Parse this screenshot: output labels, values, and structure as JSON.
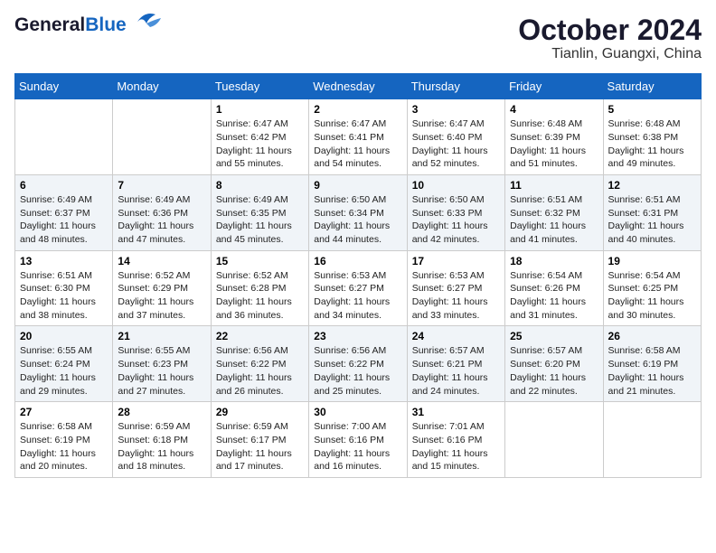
{
  "header": {
    "logo_general": "General",
    "logo_blue": "Blue",
    "month": "October 2024",
    "location": "Tianlin, Guangxi, China"
  },
  "weekdays": [
    "Sunday",
    "Monday",
    "Tuesday",
    "Wednesday",
    "Thursday",
    "Friday",
    "Saturday"
  ],
  "weeks": [
    [
      {
        "day": "",
        "sunrise": "",
        "sunset": "",
        "daylight": ""
      },
      {
        "day": "",
        "sunrise": "",
        "sunset": "",
        "daylight": ""
      },
      {
        "day": "1",
        "sunrise": "Sunrise: 6:47 AM",
        "sunset": "Sunset: 6:42 PM",
        "daylight": "Daylight: 11 hours and 55 minutes."
      },
      {
        "day": "2",
        "sunrise": "Sunrise: 6:47 AM",
        "sunset": "Sunset: 6:41 PM",
        "daylight": "Daylight: 11 hours and 54 minutes."
      },
      {
        "day": "3",
        "sunrise": "Sunrise: 6:47 AM",
        "sunset": "Sunset: 6:40 PM",
        "daylight": "Daylight: 11 hours and 52 minutes."
      },
      {
        "day": "4",
        "sunrise": "Sunrise: 6:48 AM",
        "sunset": "Sunset: 6:39 PM",
        "daylight": "Daylight: 11 hours and 51 minutes."
      },
      {
        "day": "5",
        "sunrise": "Sunrise: 6:48 AM",
        "sunset": "Sunset: 6:38 PM",
        "daylight": "Daylight: 11 hours and 49 minutes."
      }
    ],
    [
      {
        "day": "6",
        "sunrise": "Sunrise: 6:49 AM",
        "sunset": "Sunset: 6:37 PM",
        "daylight": "Daylight: 11 hours and 48 minutes."
      },
      {
        "day": "7",
        "sunrise": "Sunrise: 6:49 AM",
        "sunset": "Sunset: 6:36 PM",
        "daylight": "Daylight: 11 hours and 47 minutes."
      },
      {
        "day": "8",
        "sunrise": "Sunrise: 6:49 AM",
        "sunset": "Sunset: 6:35 PM",
        "daylight": "Daylight: 11 hours and 45 minutes."
      },
      {
        "day": "9",
        "sunrise": "Sunrise: 6:50 AM",
        "sunset": "Sunset: 6:34 PM",
        "daylight": "Daylight: 11 hours and 44 minutes."
      },
      {
        "day": "10",
        "sunrise": "Sunrise: 6:50 AM",
        "sunset": "Sunset: 6:33 PM",
        "daylight": "Daylight: 11 hours and 42 minutes."
      },
      {
        "day": "11",
        "sunrise": "Sunrise: 6:51 AM",
        "sunset": "Sunset: 6:32 PM",
        "daylight": "Daylight: 11 hours and 41 minutes."
      },
      {
        "day": "12",
        "sunrise": "Sunrise: 6:51 AM",
        "sunset": "Sunset: 6:31 PM",
        "daylight": "Daylight: 11 hours and 40 minutes."
      }
    ],
    [
      {
        "day": "13",
        "sunrise": "Sunrise: 6:51 AM",
        "sunset": "Sunset: 6:30 PM",
        "daylight": "Daylight: 11 hours and 38 minutes."
      },
      {
        "day": "14",
        "sunrise": "Sunrise: 6:52 AM",
        "sunset": "Sunset: 6:29 PM",
        "daylight": "Daylight: 11 hours and 37 minutes."
      },
      {
        "day": "15",
        "sunrise": "Sunrise: 6:52 AM",
        "sunset": "Sunset: 6:28 PM",
        "daylight": "Daylight: 11 hours and 36 minutes."
      },
      {
        "day": "16",
        "sunrise": "Sunrise: 6:53 AM",
        "sunset": "Sunset: 6:27 PM",
        "daylight": "Daylight: 11 hours and 34 minutes."
      },
      {
        "day": "17",
        "sunrise": "Sunrise: 6:53 AM",
        "sunset": "Sunset: 6:27 PM",
        "daylight": "Daylight: 11 hours and 33 minutes."
      },
      {
        "day": "18",
        "sunrise": "Sunrise: 6:54 AM",
        "sunset": "Sunset: 6:26 PM",
        "daylight": "Daylight: 11 hours and 31 minutes."
      },
      {
        "day": "19",
        "sunrise": "Sunrise: 6:54 AM",
        "sunset": "Sunset: 6:25 PM",
        "daylight": "Daylight: 11 hours and 30 minutes."
      }
    ],
    [
      {
        "day": "20",
        "sunrise": "Sunrise: 6:55 AM",
        "sunset": "Sunset: 6:24 PM",
        "daylight": "Daylight: 11 hours and 29 minutes."
      },
      {
        "day": "21",
        "sunrise": "Sunrise: 6:55 AM",
        "sunset": "Sunset: 6:23 PM",
        "daylight": "Daylight: 11 hours and 27 minutes."
      },
      {
        "day": "22",
        "sunrise": "Sunrise: 6:56 AM",
        "sunset": "Sunset: 6:22 PM",
        "daylight": "Daylight: 11 hours and 26 minutes."
      },
      {
        "day": "23",
        "sunrise": "Sunrise: 6:56 AM",
        "sunset": "Sunset: 6:22 PM",
        "daylight": "Daylight: 11 hours and 25 minutes."
      },
      {
        "day": "24",
        "sunrise": "Sunrise: 6:57 AM",
        "sunset": "Sunset: 6:21 PM",
        "daylight": "Daylight: 11 hours and 24 minutes."
      },
      {
        "day": "25",
        "sunrise": "Sunrise: 6:57 AM",
        "sunset": "Sunset: 6:20 PM",
        "daylight": "Daylight: 11 hours and 22 minutes."
      },
      {
        "day": "26",
        "sunrise": "Sunrise: 6:58 AM",
        "sunset": "Sunset: 6:19 PM",
        "daylight": "Daylight: 11 hours and 21 minutes."
      }
    ],
    [
      {
        "day": "27",
        "sunrise": "Sunrise: 6:58 AM",
        "sunset": "Sunset: 6:19 PM",
        "daylight": "Daylight: 11 hours and 20 minutes."
      },
      {
        "day": "28",
        "sunrise": "Sunrise: 6:59 AM",
        "sunset": "Sunset: 6:18 PM",
        "daylight": "Daylight: 11 hours and 18 minutes."
      },
      {
        "day": "29",
        "sunrise": "Sunrise: 6:59 AM",
        "sunset": "Sunset: 6:17 PM",
        "daylight": "Daylight: 11 hours and 17 minutes."
      },
      {
        "day": "30",
        "sunrise": "Sunrise: 7:00 AM",
        "sunset": "Sunset: 6:16 PM",
        "daylight": "Daylight: 11 hours and 16 minutes."
      },
      {
        "day": "31",
        "sunrise": "Sunrise: 7:01 AM",
        "sunset": "Sunset: 6:16 PM",
        "daylight": "Daylight: 11 hours and 15 minutes."
      },
      {
        "day": "",
        "sunrise": "",
        "sunset": "",
        "daylight": ""
      },
      {
        "day": "",
        "sunrise": "",
        "sunset": "",
        "daylight": ""
      }
    ]
  ]
}
